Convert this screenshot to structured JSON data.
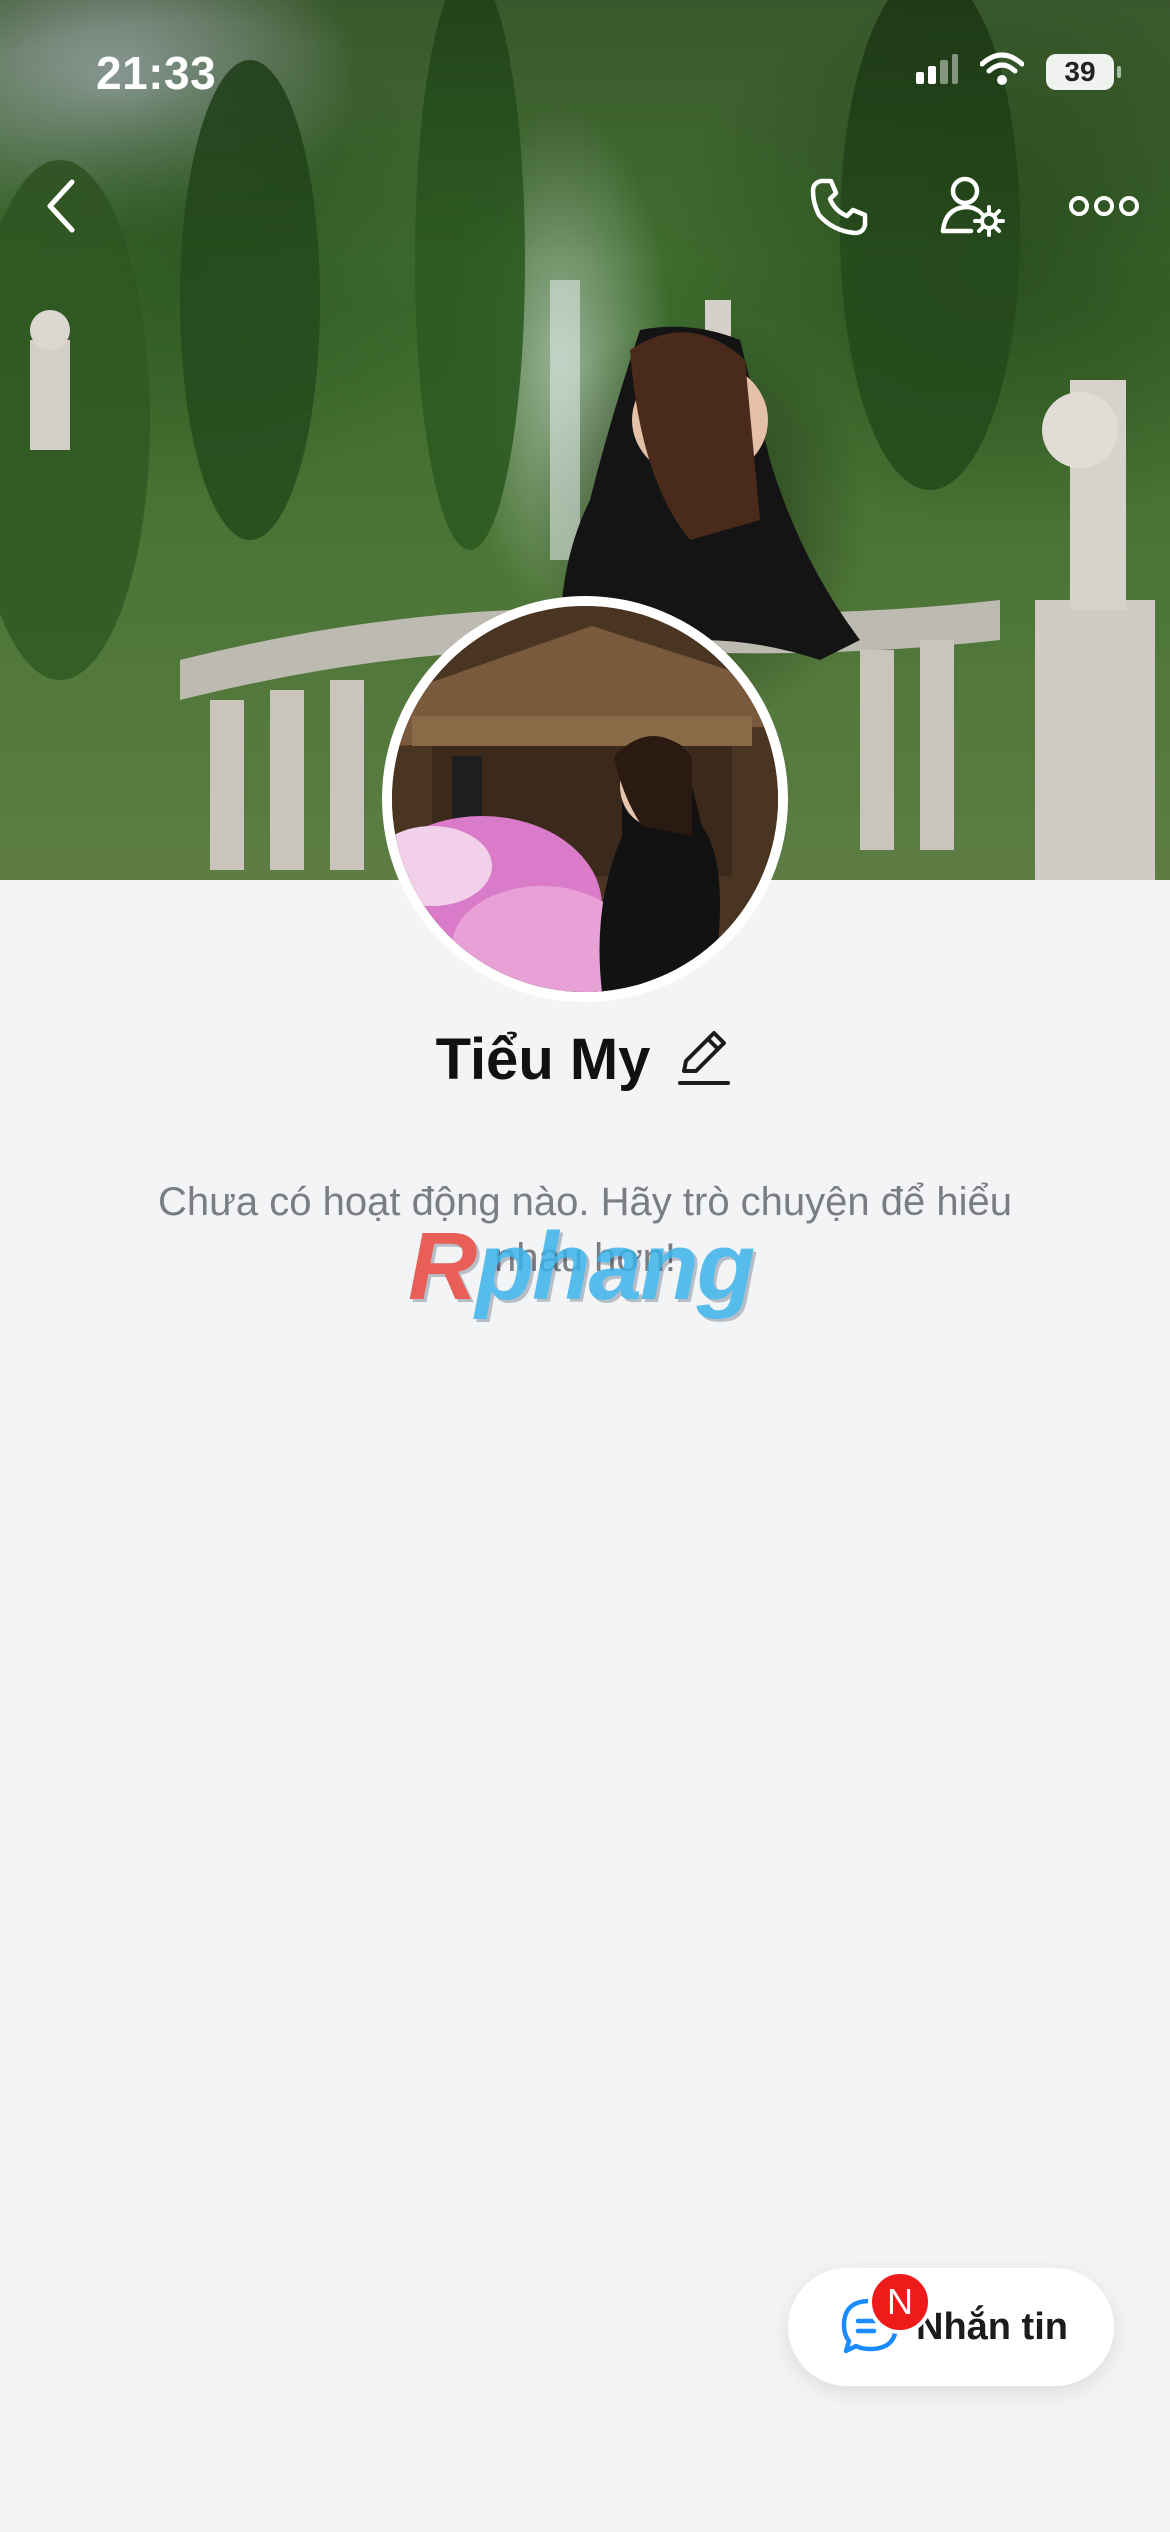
{
  "status_bar": {
    "time": "21:33",
    "battery": "39",
    "signal_icon": "signal-bars-icon",
    "wifi_icon": "wifi-icon"
  },
  "nav": {
    "back_icon": "chevron-left-icon",
    "call_icon": "phone-icon",
    "settings_icon": "user-settings-icon",
    "more_icon": "more-dots-icon"
  },
  "profile": {
    "name": "Tiểu My",
    "edit_icon": "pencil-icon",
    "empty_message": "Chưa có hoạt động nào. Hãy trò chuyện để hiểu nhau hơn!"
  },
  "watermark": {
    "first": "R",
    "rest": "phang"
  },
  "message_button": {
    "label": "Nhắn tin",
    "badge": "N",
    "icon": "chat-bubble-icon"
  },
  "colors": {
    "background": "#f3f4f6",
    "badge": "#ef1b1b",
    "chat_icon": "#1a8cff"
  }
}
